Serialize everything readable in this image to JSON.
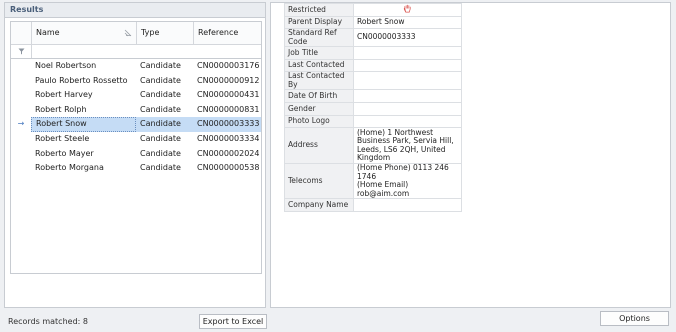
{
  "results": {
    "title": "Results",
    "columns": {
      "name": "Name",
      "type": "Type",
      "reference": "Reference"
    },
    "rows": [
      {
        "name": "Noel Robertson",
        "type": "Candidate",
        "reference": "CN0000003176"
      },
      {
        "name": "Paulo Roberto Rossetto",
        "type": "Candidate",
        "reference": "CN0000000912"
      },
      {
        "name": "Robert Harvey",
        "type": "Candidate",
        "reference": "CN0000000431"
      },
      {
        "name": "Robert Rolph",
        "type": "Candidate",
        "reference": "CN0000000831"
      },
      {
        "name": "Robert Snow",
        "type": "Candidate",
        "reference": "CN0000003333"
      },
      {
        "name": "Robert Steele",
        "type": "Candidate",
        "reference": "CN0000003334"
      },
      {
        "name": "Roberto Mayer",
        "type": "Candidate",
        "reference": "CN0000002024"
      },
      {
        "name": "Roberto Morgana",
        "type": "Candidate",
        "reference": "CN0000000538"
      }
    ],
    "selected_row_marker": "→",
    "records_matched": "Records matched: 8",
    "export_label": "Export to Excel"
  },
  "details": {
    "rows": [
      {
        "label": "Restricted",
        "value": ""
      },
      {
        "label": "Parent Display",
        "value": "Robert Snow"
      },
      {
        "label": "Standard Ref Code",
        "value": "CN0000003333"
      },
      {
        "label": "Job Title",
        "value": ""
      },
      {
        "label": "Last Contacted",
        "value": ""
      },
      {
        "label": "Last Contacted By",
        "value": ""
      },
      {
        "label": "Date Of Birth",
        "value": ""
      },
      {
        "label": "Gender",
        "value": ""
      },
      {
        "label": "Photo Logo",
        "value": ""
      },
      {
        "label": "Address",
        "value": "(Home) 1 Northwest Business Park, Servia Hill, Leeds, LS6 2QH, United Kingdom"
      },
      {
        "label": "Telecoms",
        "value": "(Home Phone) 0113 246 1746\n(Home Email) rob@aim.com"
      },
      {
        "label": "Company Name",
        "value": ""
      }
    ],
    "restricted_icon": "hand-stop-icon",
    "restricted_icon_color": "#d9534f"
  },
  "options_label": "Options",
  "colors": {
    "selection": "#c5dcf5",
    "title": "#4a5f7a"
  }
}
